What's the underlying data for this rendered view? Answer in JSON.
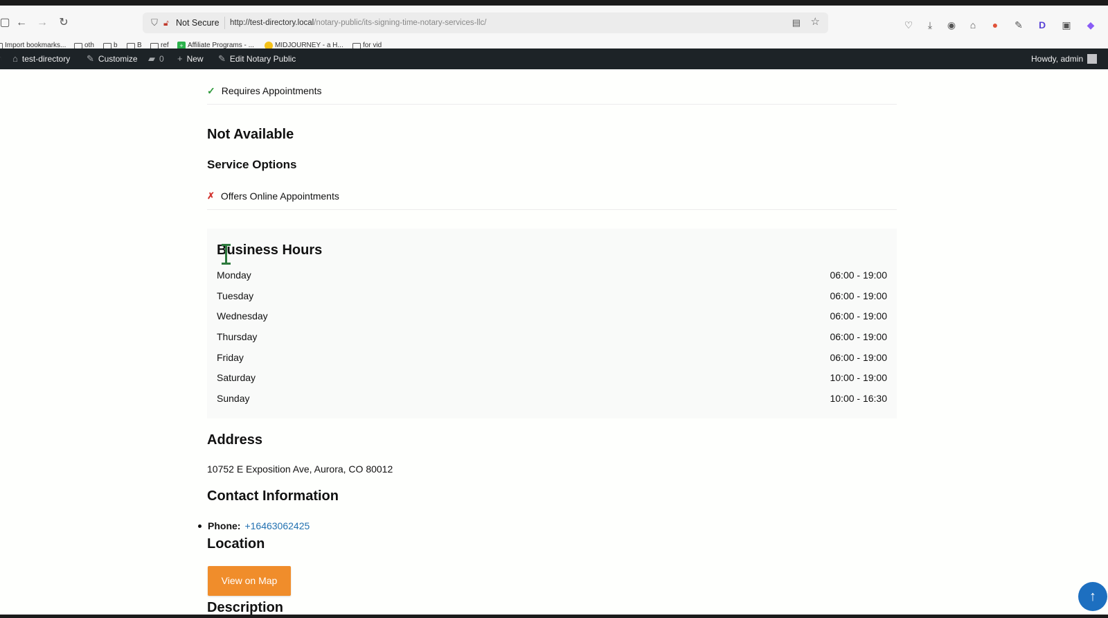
{
  "browser": {
    "security_label": "Not Secure",
    "url_host": "http://test-directory.local",
    "url_path": "/notary-public/its-signing-time-notary-services-llc/",
    "bookmarks": [
      {
        "label": "Import bookmarks...",
        "type": "link"
      },
      {
        "label": "oth",
        "type": "folder"
      },
      {
        "label": "b",
        "type": "folder"
      },
      {
        "label": "B",
        "type": "folder"
      },
      {
        "label": "ref",
        "type": "folder"
      },
      {
        "label": "Affiliate Programs - ...",
        "type": "green"
      },
      {
        "label": "MIDJOURNEY - a H...",
        "type": "yellow"
      },
      {
        "label": "for vid",
        "type": "folder"
      }
    ]
  },
  "admin_bar": {
    "site_name": "test-directory",
    "customize": "Customize",
    "comments_count": "0",
    "new": "New",
    "edit": "Edit Notary Public",
    "howdy": "Howdy, admin"
  },
  "listing": {
    "requires_appointments": "Requires Appointments",
    "not_available_heading": "Not Available",
    "service_options_heading": "Service Options",
    "offers_online_appointments": "Offers Online Appointments",
    "business_hours": {
      "title": "Business Hours",
      "days": [
        {
          "day": "Monday",
          "hours": "06:00 - 19:00"
        },
        {
          "day": "Tuesday",
          "hours": "06:00 - 19:00"
        },
        {
          "day": "Wednesday",
          "hours": "06:00 - 19:00"
        },
        {
          "day": "Thursday",
          "hours": "06:00 - 19:00"
        },
        {
          "day": "Friday",
          "hours": "06:00 - 19:00"
        },
        {
          "day": "Saturday",
          "hours": "10:00 - 19:00"
        },
        {
          "day": "Sunday",
          "hours": "10:00 - 16:30"
        }
      ]
    },
    "address_heading": "Address",
    "address": "10752 E Exposition Ave, Aurora, CO 80012",
    "contact_heading": "Contact Information",
    "phone_label": "Phone:",
    "phone": "+16463062425",
    "location_heading": "Location",
    "map_button": "View on Map",
    "description_heading": "Description"
  },
  "colors": {
    "admin_bar_bg": "#1d2327",
    "map_button": "#f08d2b",
    "link": "#2271b1",
    "check": "#2e9a3a",
    "cross": "#d2332e",
    "scroll_top": "#1d6fc0"
  }
}
